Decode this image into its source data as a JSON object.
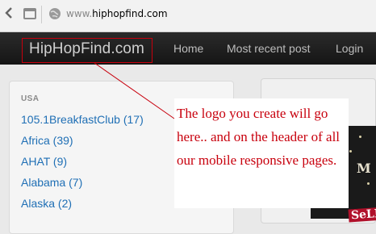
{
  "browser": {
    "url_prefix": "www.",
    "url_host": "hiphopfind.com",
    "icons": [
      "back-icon",
      "tab-grid-icon",
      "globe-icon"
    ]
  },
  "navbar": {
    "brand": "HipHopFind.com",
    "links": [
      "Home",
      "Most recent post",
      "Login"
    ]
  },
  "sidebar": {
    "heading": "USA",
    "categories": [
      "105.1BreakfastClub (17)",
      "Africa (39)",
      "AHAT (9)",
      "Alabama (7)",
      "Alaska (2)"
    ]
  },
  "annotation": {
    "text": "The logo you create will go here.. and on the header of all our mobile responsive pages.",
    "color": "#c8000d"
  },
  "promo": {
    "letter": "M",
    "text": "SeLL"
  },
  "colors": {
    "navbar": "#1f1f1f",
    "link": "#1f6fb5",
    "annotation": "#c8000d"
  }
}
